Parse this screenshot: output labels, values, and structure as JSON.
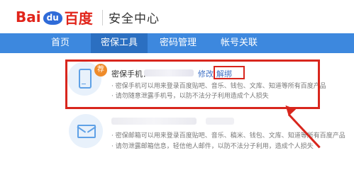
{
  "header": {
    "logo": {
      "bai": "Bai",
      "du": "du",
      "cn": "百度"
    },
    "title": "安全中心"
  },
  "nav": {
    "items": [
      "首页",
      "密保工具",
      "密码管理",
      "帐号关联"
    ],
    "active_index": 1
  },
  "phone_card": {
    "badge": "荐",
    "title": "密保手机：",
    "edit_label": "修改",
    "unbind_label": "解绑",
    "desc": [
      "· 密保手机可以用来登录百度贴吧、音乐、钱包、文库、知道等所有百度产品",
      "· 请勿随意泄露手机号，以防不法分子利用造成个人损失"
    ]
  },
  "email_card": {
    "desc": [
      "· 密保邮箱可以用来登录百度贴吧、音乐、稿米、钱包、文库、知道等所有百度产品",
      "· 请勿泄露邮箱信息，轻信他人邮件，以防不法分子利用，造成个人损失"
    ]
  },
  "colors": {
    "nav_bg": "#3d88de",
    "nav_active": "#2b6fc1",
    "highlight_red": "#d8261d",
    "link_blue": "#3d6fc4",
    "badge_orange": "#ef8b2a"
  }
}
